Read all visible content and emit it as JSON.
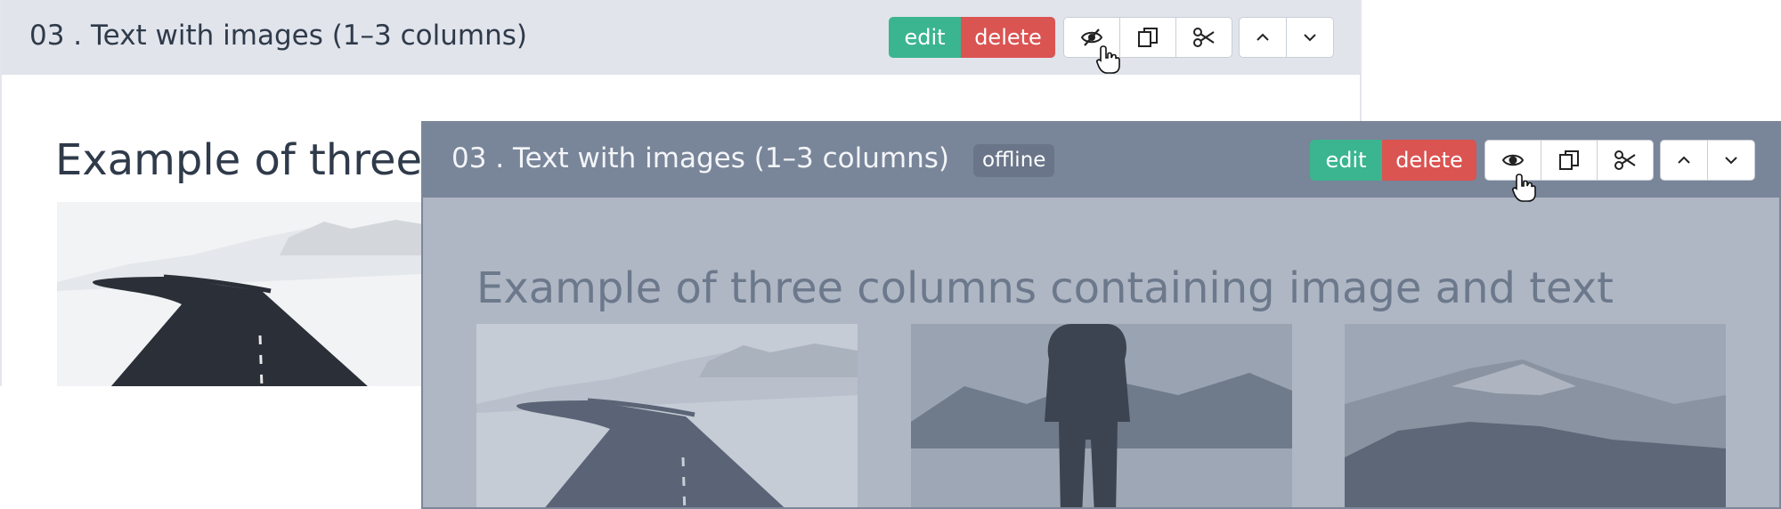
{
  "back_panel": {
    "title": "03 . Text with images (1–3 columns)",
    "heading": "Example of three columns containing image and text",
    "toolbar": {
      "edit_label": "edit",
      "delete_label": "delete",
      "visibility_icon": "eye-slash-icon",
      "copy_icon": "copy-icon",
      "cut_icon": "scissors-icon",
      "move_up_icon": "chevron-up-icon",
      "move_down_icon": "chevron-down-icon"
    },
    "image": "snowy-road-image"
  },
  "front_panel": {
    "title": "03 . Text with images (1–3 columns)",
    "status_badge": "offline",
    "heading": "Example of three columns containing image and text",
    "toolbar": {
      "edit_label": "edit",
      "delete_label": "delete",
      "visibility_icon": "eye-icon",
      "copy_icon": "copy-icon",
      "cut_icon": "scissors-icon",
      "move_up_icon": "chevron-up-icon",
      "move_down_icon": "chevron-down-icon"
    },
    "images": [
      "snowy-road-image",
      "person-in-fog-image",
      "forest-mountain-image"
    ]
  },
  "colors": {
    "edit": "#3bb58f",
    "delete": "#da5452",
    "back_header": "#e1e4eb",
    "front_header": "#798599",
    "front_body": "#afb7c4"
  }
}
